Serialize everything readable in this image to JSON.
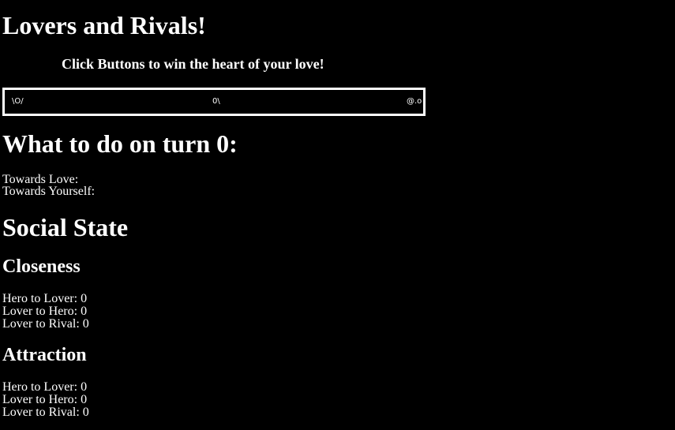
{
  "header": {
    "title": "Lovers and Rivals!",
    "subtitle": "Click Buttons to win the heart of your love!"
  },
  "stage": {
    "hero": "\\O/",
    "lover": "0\\",
    "rival": "@.o"
  },
  "turn": {
    "label": "What to do on turn",
    "number": "0",
    "suffix": ":",
    "towards_love_label": "Towards Love:",
    "towards_yourself_label": "Towards Yourself:"
  },
  "social_state": {
    "title": "Social State",
    "closeness": {
      "title": "Closeness",
      "hero_to_lover": "Hero to Lover: 0",
      "lover_to_hero": "Lover to Hero: 0",
      "lover_to_rival": "Lover to Rival: 0"
    },
    "attraction": {
      "title": "Attraction",
      "hero_to_lover": "Hero to Lover: 0",
      "lover_to_hero": "Lover to Hero: 0",
      "lover_to_rival": "Lover to Rival: 0"
    }
  },
  "colors": {
    "background": "#000000",
    "text": "#ffffff",
    "stage_border": "#ffffff"
  }
}
